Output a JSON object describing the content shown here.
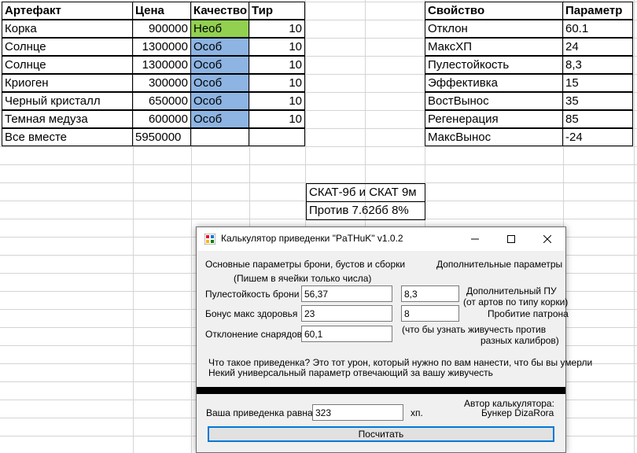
{
  "sheet": {
    "artifacts": {
      "headers": [
        "Артефакт",
        "Цена",
        "Качество",
        "Тир"
      ],
      "rows": [
        {
          "name": "Корка",
          "price": "900000",
          "quality": "Необ",
          "tier": "10"
        },
        {
          "name": "Солнце",
          "price": "1300000",
          "quality": "Особ",
          "tier": "10"
        },
        {
          "name": "Солнце",
          "price": "1300000",
          "quality": "Особ",
          "tier": "10"
        },
        {
          "name": "Криоген",
          "price": "300000",
          "quality": "Особ",
          "tier": "10"
        },
        {
          "name": "Черный кристалл",
          "price": "650000",
          "quality": "Особ",
          "tier": "10"
        },
        {
          "name": "Темная медуза",
          "price": "600000",
          "quality": "Особ",
          "tier": "10"
        }
      ],
      "total_label": "Все вместе",
      "total_price": "5950000"
    },
    "props": {
      "headers": [
        "Свойство",
        "Параметр"
      ],
      "rows": [
        {
          "name": "Отклон",
          "value": "60.1"
        },
        {
          "name": "МаксХП",
          "value": "24"
        },
        {
          "name": "Пулестойкость",
          "value": "8,3"
        },
        {
          "name": "Эффективка",
          "value": "15"
        },
        {
          "name": "ВостВынос",
          "value": "35"
        },
        {
          "name": "Регенерация",
          "value": "85"
        },
        {
          "name": "МаксВынос",
          "value": "-24"
        }
      ]
    },
    "note_line1": "СКАТ-9б и СКАТ 9м",
    "note_line2": "Против 7.62бб 8%",
    "colors": {
      "necommon": "#92d050",
      "special": "#8db4e2"
    }
  },
  "dialog": {
    "title": "Калькулятор приведенки \"PaTHuK\" v1.0.2",
    "section_main": "Основные параметры брони, бустов и сборки",
    "section_hint": "(Пишем в ячейки только числа)",
    "section_extra": "Дополнительные параметры",
    "armor_label": "Пулестойкость брони",
    "armor_value": "56,37",
    "hp_label": "Бонус макс здоровья",
    "hp_value": "23",
    "spread_label": "Отклонение снарядов",
    "spread_value": "60,1",
    "extra_pu_value": "8,3",
    "extra_pu_label1": "Дополнительный ПУ",
    "extra_pu_label2": "(от артов по типу корки)",
    "pierce_value": "8",
    "pierce_label": "Пробитие патрона",
    "pierce_note1": "(что бы узнать живучесть против",
    "pierce_note2": "разных калибров)",
    "explain1": "Что такое приведенка? Это тот урон, который нужно по вам нанести, что бы вы умерли",
    "explain2": "Некий универсальный параметр отвечающий за вашу живучесть",
    "result_label": "Ваша приведенка равна:",
    "result_value": "323",
    "result_unit": "хп.",
    "author1": "Автор калькулятора:",
    "author2": "Бункер DizaRora",
    "calc_button": "Посчитать",
    "min_icon": "minimize-icon",
    "max_icon": "maximize-icon",
    "close_icon": "close-icon"
  }
}
